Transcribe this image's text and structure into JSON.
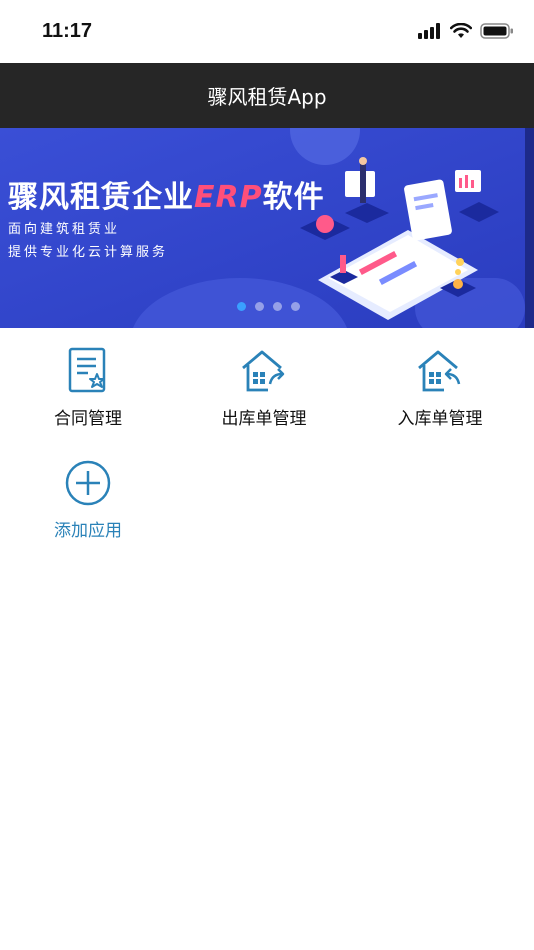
{
  "status_bar": {
    "time": "11:17",
    "icons": [
      "signal-icon",
      "wifi-icon",
      "battery-icon"
    ]
  },
  "nav": {
    "title": "骤风租赁App"
  },
  "banner": {
    "headline_main": "骤风租赁企业",
    "headline_accent": "ERP",
    "headline_tail": "软件",
    "subtitle_line1": "面向建筑租赁业",
    "subtitle_line2": "提供专业化云计算服务",
    "total_slides": 4,
    "active_slide": 1,
    "colors": {
      "background": "#2f45c9",
      "accent": "#ff4f7a"
    }
  },
  "apps": [
    {
      "label": "合同管理",
      "icon": "contract-document-icon"
    },
    {
      "label": "出库单管理",
      "icon": "warehouse-outbound-icon"
    },
    {
      "label": "入库单管理",
      "icon": "warehouse-inbound-icon"
    },
    {
      "label": "添加应用",
      "icon": "add-circle-icon"
    }
  ],
  "colors": {
    "nav_background": "#262626",
    "icon_blue": "#2a82b8",
    "add_label": "#2a82b8"
  }
}
